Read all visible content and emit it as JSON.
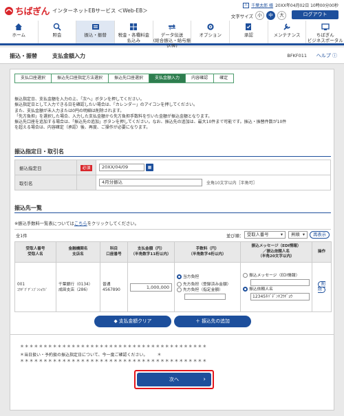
{
  "header": {
    "logo": "ちばぎん",
    "service": "インターネットEBサービス ＜Web-EB＞",
    "user_name": "千葉太郎 様",
    "last_login": "20XX年04月02日 10時00分00秒",
    "text_size_label": "文字サイズ",
    "sizes": [
      "小",
      "中",
      "大"
    ],
    "logout": "ログアウト"
  },
  "nav": [
    {
      "label": "ホーム"
    },
    {
      "label": "照会"
    },
    {
      "label": "振込・振替"
    },
    {
      "label": "税金・各種料金\n払込み"
    },
    {
      "label": "データ伝送\n(総合振込・給与振込等)"
    },
    {
      "label": "オプション"
    },
    {
      "label": "承認"
    },
    {
      "label": "メンテナンス"
    },
    {
      "label": "ちばぎん\nビジネスポータル"
    }
  ],
  "titlebar": {
    "category": "振込・振替",
    "title": "支払金額入力",
    "screen_code": "BFKF011",
    "help": "ヘルプ"
  },
  "steps": [
    "支払口座選択",
    "振込先口座指定方法選択",
    "振込先口座選択",
    "支払金額入力",
    "内容確認",
    "確定"
  ],
  "intro": [
    "振込指定日、支払金額を入力の上、「次へ」ボタンを押してください。",
    "振込指定日として入力できる日を確認したい場合は、「カレンダー」のアイコンを押してください。",
    "また、支払金額が未入力または0円の明細は削除されます。",
    "「先方負担」を選択した場合、入力した支払金額から先方負担手数料を引いた金額が振込金額となります。",
    "振込先口座を追加する場合は、「振込先の追加」ボタンを押してください。なお、振込先の追加は、最大10件まで可能です。振込・振替件数が10件",
    "を超える場合は、内容確定（承認）後、再度、ご操作が必要になります。"
  ],
  "section1": {
    "title": "振込指定日・取引名",
    "date_label": "振込指定日",
    "required": "必須",
    "date_value": "20XX/04/09",
    "name_label": "取引名",
    "name_value": "4月分振込",
    "name_note": "全角10文字以内［半角可］"
  },
  "section2": {
    "title": "振込先一覧",
    "fee_note_prefix": "※振込手数料一覧表については",
    "fee_note_link": "こちら",
    "fee_note_suffix": "をクリックしてください。",
    "count": "全1件",
    "sort_label": "並び順：",
    "sort_value": "受取人番号",
    "order_value": "昇順",
    "reshow": "再表示"
  },
  "table": {
    "headers": [
      "受取人番号\n受取人名",
      "金融機関名\n支店名",
      "科目\n口座番号",
      "支払金額（円）\n（半角数字11桁以内）",
      "手数料（円）\n（半角数字4桁以内）",
      "振込メッセージ（EDI情報）\n／振込依頼人名\n（半角20文字以内）",
      "操作"
    ],
    "row": {
      "recipient_no": "001",
      "recipient_name": "ｺｳｻﾞｸﾞﾁﾞﾝﾌﾞﾝｼｮｳｼﾞ",
      "bank": "千葉銀行（0134）",
      "branch": "成田支店（286）",
      "subject": "普通",
      "account": "4567890",
      "amount": "1,000,000",
      "fee_options": [
        "当方負担",
        "先方負担（登録済み金額）",
        "先方負担（指定金額）"
      ],
      "message_option": "振込メッセージ（EDI情報）",
      "requester_option": "振込依頼人名",
      "requester_value": "12345ﾁﾊﾞﾃﾞﾝｷｺｳｷﾞｮｳ",
      "delete": "削除"
    }
  },
  "buttons": {
    "clear": "支払金額クリア",
    "add": "振込先の追加",
    "next": "次へ"
  },
  "stars": "＊＊＊＊＊＊＊＊＊＊＊＊＊＊＊＊＊＊＊＊＊＊＊＊＊＊＊＊＊＊＊＊＊＊＊＊＊＊＊＊",
  "warning": "＊当日扱い・予約扱の振込指定日について、今一度ご確認ください。",
  "warning_tail": "＊"
}
